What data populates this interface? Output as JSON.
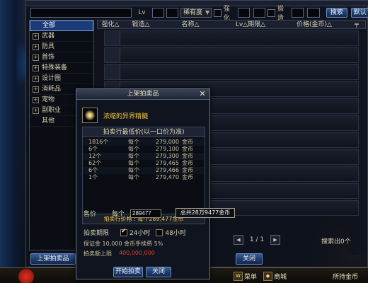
{
  "search": {
    "input_value": "",
    "level_label": "Lv",
    "rarity_value": "稀有度",
    "enhance_label": "强化",
    "forge_label": "锻造",
    "search_btn": "搜索",
    "reset_btn": "默认"
  },
  "categories": [
    {
      "label": "全部",
      "expand": false,
      "selected": true
    },
    {
      "label": "武器",
      "expand": true
    },
    {
      "label": "防具",
      "expand": true
    },
    {
      "label": "首饰",
      "expand": true
    },
    {
      "label": "特殊装备",
      "expand": true
    },
    {
      "label": "设计图",
      "expand": true
    },
    {
      "label": "消耗品",
      "expand": true
    },
    {
      "label": "宠物",
      "expand": true
    },
    {
      "label": "副职业",
      "expand": true
    },
    {
      "label": "其他",
      "expand": false
    }
  ],
  "columns": [
    "强化△",
    "锻造△",
    "名称△",
    "Lv△期限△",
    "价格(金币)△"
  ],
  "search_count": "搜索出0个",
  "pager": {
    "page": "1 / 1"
  },
  "list_up_btn": "上架拍卖品",
  "bg_close_btn": "关闭",
  "hud": {
    "menu": "菜单",
    "shop": "商城",
    "gold_label": "所持金币"
  },
  "dialog": {
    "title": "上架拍卖品",
    "item_name": "浓缩的异界精髓",
    "table_head": "拍卖行最低价(以一口价为准)",
    "rows": [
      {
        "qty": "1816个",
        "each": "每个",
        "price": "279,000",
        "unit": "金币"
      },
      {
        "qty": "6个",
        "each": "每个",
        "price": "279,100",
        "unit": "金币"
      },
      {
        "qty": "12个",
        "each": "每个",
        "price": "279,300",
        "unit": "金币"
      },
      {
        "qty": "62个",
        "each": "每个",
        "price": "279,465",
        "unit": "金币"
      },
      {
        "qty": "6个",
        "each": "每个",
        "price": "279,466",
        "unit": "金币"
      },
      {
        "qty": "1个",
        "each": "每个",
        "price": "279,470",
        "unit": "金币"
      }
    ],
    "summary": "拍卖行价格 : 每个289,477金币",
    "price_label": "售价",
    "each_label": "每个",
    "price_value": "289477",
    "tooltip": "总共28万9477金币",
    "period_label": "拍卖期限",
    "period_24": "24小时",
    "period_48": "48小时",
    "deposit": "保证金 10,000 金币手续费 5%",
    "ceiling_label": "拍卖额上限",
    "ceiling_value": "400,000,000",
    "start_btn": "开始拍卖",
    "close_btn": "关闭"
  }
}
